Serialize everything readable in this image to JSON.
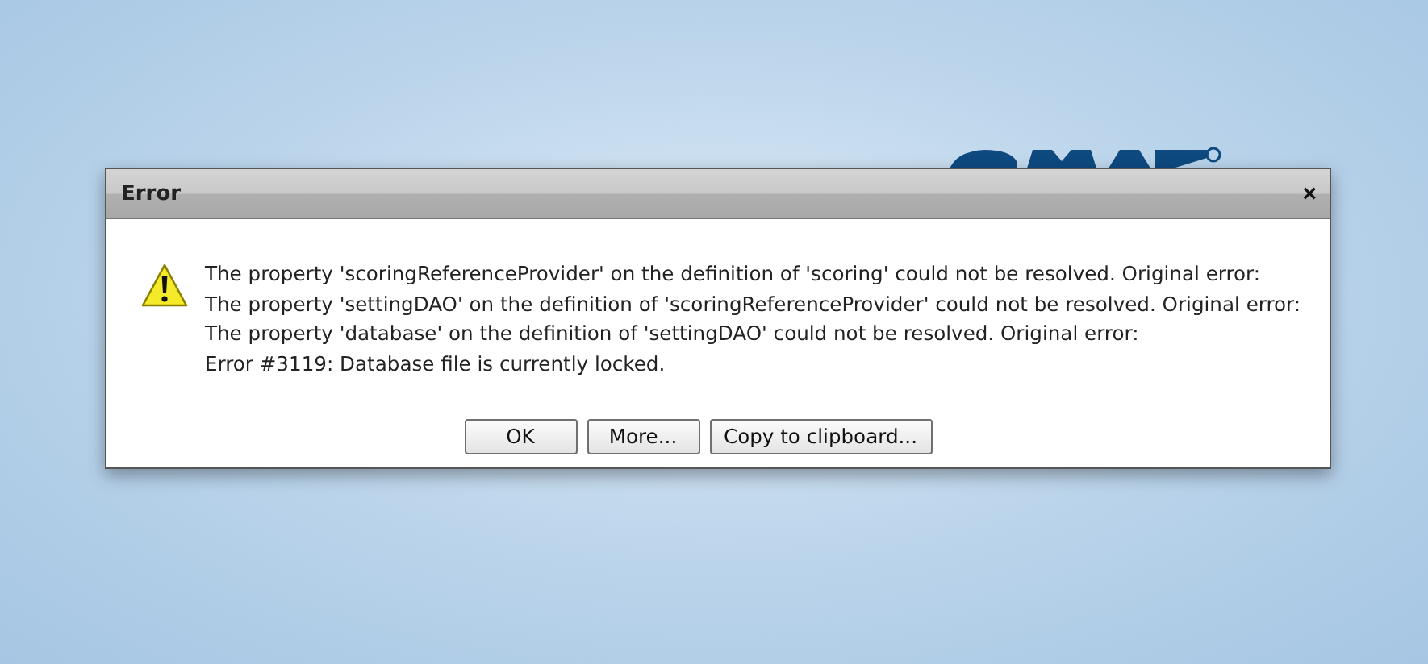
{
  "dialog": {
    "title": "Error",
    "close": "×",
    "message": [
      "The property 'scoringReferenceProvider' on the definition of 'scoring' could not be resolved. Original error:",
      "The property 'settingDAO' on the definition of 'scoringReferenceProvider' could not be resolved. Original error:",
      "The property 'database' on the definition of 'settingDAO' could not be resolved. Original error:",
      "Error #3119: Database file is currently locked."
    ],
    "buttons": [
      "OK",
      "More...",
      "Copy to clipboard..."
    ]
  }
}
